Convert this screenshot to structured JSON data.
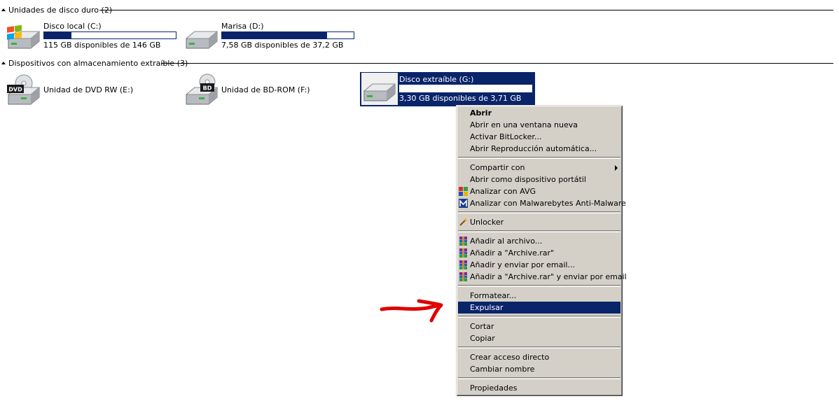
{
  "groups": {
    "hard_disks": {
      "title": "Unidades de disco duro (2)"
    },
    "removable": {
      "title": "Dispositivos con almacenamiento extraíble (3)"
    }
  },
  "drives": {
    "c": {
      "name": "Disco local (C:)",
      "free": "115 GB disponibles de 146 GB",
      "used_fraction": 0.21,
      "icon": "windows-hdd-icon"
    },
    "d": {
      "name": "Marisa (D:)",
      "free": "7,58 GB disponibles de 37,2 GB",
      "used_fraction": 0.8,
      "icon": "hdd-icon"
    },
    "e": {
      "name": "Unidad de DVD RW (E:)",
      "icon": "dvd-drive-icon",
      "badge": "DVD"
    },
    "f": {
      "name": "Unidad de BD-ROM (F:)",
      "icon": "bd-drive-icon",
      "badge": "BD"
    },
    "g": {
      "name": "Disco extraíble (G:)",
      "free": "3,30 GB disponibles de 3,71 GB",
      "used_fraction": 0.11,
      "icon": "removable-disk-icon",
      "selected": true
    }
  },
  "context_menu": {
    "items": [
      {
        "label": "Abrir",
        "bold": true
      },
      {
        "label": "Abrir en una ventana nueva"
      },
      {
        "label": "Activar BitLocker..."
      },
      {
        "label": "Abrir Reproducción automática..."
      },
      {
        "label": "Compartir con",
        "submenu": true
      },
      {
        "label": "Abrir como dispositivo portátil"
      },
      {
        "label": "Analizar con AVG",
        "icon": "avg-icon"
      },
      {
        "label": "Analizar con Malwarebytes Anti-Malware",
        "icon": "malwarebytes-icon"
      },
      {
        "label": "Unlocker",
        "icon": "unlocker-wand-icon"
      },
      {
        "label": "Añadir al archivo...",
        "icon": "winrar-icon"
      },
      {
        "label": "Añadir a \"Archive.rar\"",
        "icon": "winrar-icon"
      },
      {
        "label": "Añadir y enviar por email...",
        "icon": "winrar-icon"
      },
      {
        "label": "Añadir a \"Archive.rar\" y enviar por email",
        "icon": "winrar-icon"
      },
      {
        "label": "Formatear..."
      },
      {
        "label": "Expulsar",
        "highlighted": true
      },
      {
        "label": "Cortar"
      },
      {
        "label": "Copiar"
      },
      {
        "label": "Crear acceso directo"
      },
      {
        "label": "Cambiar nombre"
      },
      {
        "label": "Propiedades"
      }
    ]
  },
  "colors": {
    "selection": "#0a246a",
    "menu_bg": "#d4d0c8",
    "annotation_arrow": "#e00000"
  }
}
